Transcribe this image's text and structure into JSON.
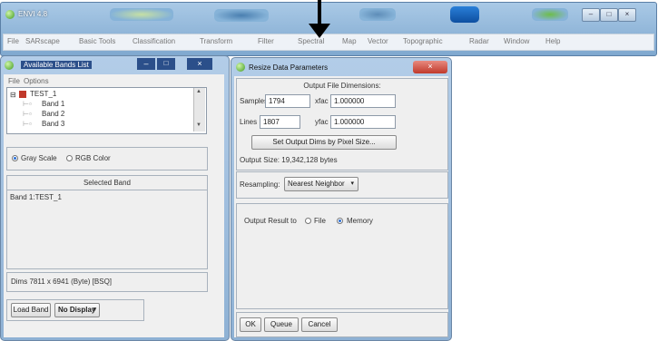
{
  "app": {
    "title": "ENVI 4.8",
    "menu": [
      "File",
      "SARscape",
      "Basic Tools",
      "Classification",
      "Transform",
      "Filter",
      "Spectral",
      "Map",
      "Vector",
      "Topographic",
      "Radar",
      "Window",
      "Help"
    ]
  },
  "bands_window": {
    "title": "Available Bands List",
    "menu": [
      "File",
      "Options"
    ],
    "tree": {
      "file": "TEST_1",
      "bands": [
        "Band 1",
        "Band 2",
        "Band 3"
      ]
    },
    "mode_gray": "Gray Scale",
    "mode_rgb": "RGB Color",
    "selected_band_label": "Selected Band",
    "selected_band_value": "Band 1:TEST_1",
    "dims": "Dims 7811 x 6941 (Byte) [BSQ]",
    "load_band": "Load Band",
    "no_display": "No Display"
  },
  "resize_dialog": {
    "title": "Resize Data Parameters",
    "output_dims_label": "Output File Dimensions:",
    "samples_label": "Samples",
    "samples_value": "1794",
    "xfac_label": "xfac",
    "xfac_value": "1.000000",
    "lines_label": "Lines",
    "lines_value": "1807",
    "yfac_label": "yfac",
    "yfac_value": "1.000000",
    "set_dims_button": "Set Output Dims by Pixel Size...",
    "output_size": "Output Size: 19,342,128 bytes",
    "resampling_label": "Resampling:",
    "resampling_value": "Nearest Neighbor",
    "output_result_label": "Output Result to",
    "opt_file": "File",
    "opt_memory": "Memory",
    "ok": "OK",
    "queue": "Queue",
    "cancel": "Cancel"
  },
  "icons": {
    "close": "close-icon",
    "minimize": "minimize-icon",
    "maximize": "maximize-icon",
    "dropdown": "chevron-down-icon",
    "arrow": "arrow-down-icon"
  },
  "colors": {
    "titlebar": "#8eb1d4",
    "close_red": "#d9463b",
    "dark_bar": "#2b4f8a",
    "radio_dot": "#2b6fd6"
  }
}
